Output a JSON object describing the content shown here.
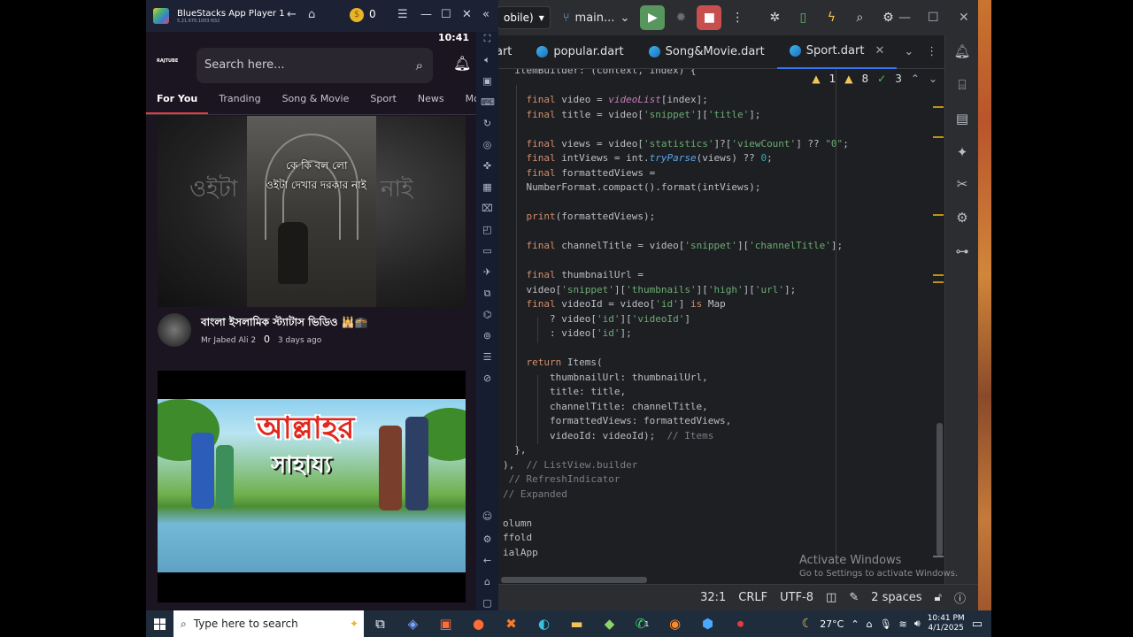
{
  "bluestacks": {
    "title": "BlueStacks App Player 1",
    "version": "5.21.670.1003  N32",
    "coins": "0",
    "colors": {
      "bar": "#1c2233",
      "side": "#161d31"
    }
  },
  "phone": {
    "time": "10:41",
    "app_logo": "RAJTUBE",
    "search_placeholder": "Search here...",
    "tabs": [
      "For You",
      "Tranding",
      "Song & Movie",
      "Sport",
      "News",
      "Motiva"
    ],
    "active_tab": "For You",
    "videos": [
      {
        "thumbnail_text_1": "কে কি বল লো",
        "thumbnail_text_2": "ওইটা দেখার দরকার নাই",
        "ghost_left": "ওইটা",
        "ghost_right": "নাই",
        "title": "বাংলা ইসলামিক স্ট্যাটাস ভিডিও 🕌🕋",
        "channel": "Mr Jabed Ali 2",
        "views": "0",
        "age": "3 days ago"
      },
      {
        "thumbnail_text_1": "আল্লাহর",
        "thumbnail_text_2": "সাহায্য"
      }
    ],
    "accent": "#e33d3d"
  },
  "ide": {
    "run_config": "obile)",
    "branch": "main...",
    "tabs": [
      "art",
      "popular.dart",
      "Song&Movie.dart",
      "Sport.dart"
    ],
    "active_tab": "Sport.dart",
    "inspections": {
      "warnings_a": "1",
      "warnings_b": "8",
      "ok": "3"
    },
    "code": [
      "  itemBuilder: (context, index) {",
      "",
      "    final video = videoList[index];",
      "    final title = video['snippet']['title'];",
      "",
      "    final views = video['statistics']?['viewCount'] ?? \"0\";",
      "    final intViews = int.tryParse(views) ?? 0;",
      "    final formattedViews =",
      "    NumberFormat.compact().format(intViews);",
      "",
      "    print(formattedViews);",
      "",
      "    final channelTitle = video['snippet']['channelTitle'];",
      "",
      "    final thumbnailUrl =",
      "    video['snippet']['thumbnails']['high']['url'];",
      "    final videoId = video['id'] is Map",
      "        ? video['id']['videoId']",
      "        : video['id'];",
      "",
      "    return Items(",
      "        thumbnailUrl: thumbnailUrl,",
      "        title: title,",
      "        channelTitle: channelTitle,",
      "        formattedViews: formattedViews,",
      "        videoId: videoId);  // Items",
      "  },",
      "),  // ListView.builder",
      " // RefreshIndicator",
      "// Expanded",
      "",
      "olumn",
      "ffold",
      "ialApp"
    ],
    "status": {
      "position": "32:1",
      "line_ending": "CRLF",
      "encoding": "UTF-8",
      "indent": "2 spaces"
    },
    "colors": {
      "bg": "#1e1f22",
      "bar": "#2b2d30",
      "keyword": "#cf8e6d",
      "string": "#6aab73",
      "number": "#2aacb8"
    }
  },
  "watermark": {
    "title": "Activate Windows",
    "subtitle": "Go to Settings to activate Windows."
  },
  "taskbar": {
    "search_placeholder": "Type here to search",
    "weather": "27°C",
    "time": "10:41 PM",
    "date": "4/1/2025",
    "badge": "1"
  }
}
